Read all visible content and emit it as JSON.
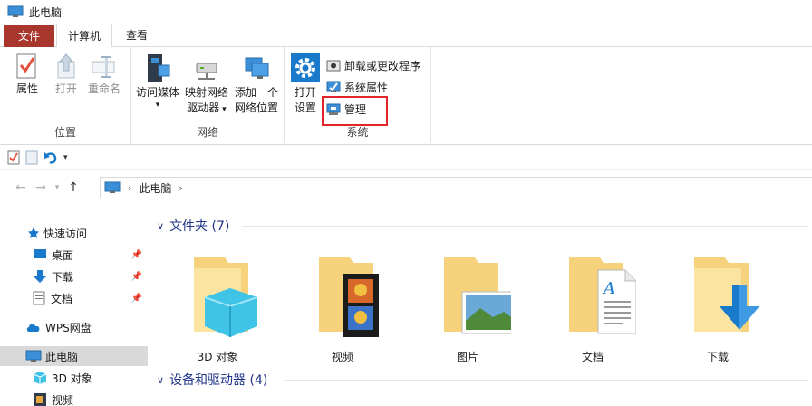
{
  "window": {
    "title": "此电脑"
  },
  "tabs": {
    "file": "文件",
    "computer": "计算机",
    "view": "查看"
  },
  "ribbon": {
    "location": {
      "label": "位置",
      "properties": "属性",
      "open": "打开",
      "rename": "重命名"
    },
    "network": {
      "label": "网络",
      "access_media": "访问媒体",
      "map_drive_line1": "映射网络",
      "map_drive_line2": "驱动器",
      "add_location_line1": "添加一个",
      "add_location_line2": "网络位置"
    },
    "system": {
      "label": "系统",
      "open_settings_line1": "打开",
      "open_settings_line2": "设置",
      "uninstall": "卸载或更改程序",
      "system_properties": "系统属性",
      "manage": "管理"
    }
  },
  "address": {
    "root": "此电脑"
  },
  "sidebar": {
    "items": [
      {
        "label": "快速访问"
      },
      {
        "label": "桌面"
      },
      {
        "label": "下载"
      },
      {
        "label": "文档"
      },
      {
        "label": "WPS网盘"
      },
      {
        "label": "此电脑"
      },
      {
        "label": "3D 对象"
      },
      {
        "label": "视频"
      }
    ]
  },
  "content": {
    "folders_header": "文件夹 (7)",
    "devices_header": "设备和驱动器 (4)",
    "folders": [
      {
        "name": "3D 对象"
      },
      {
        "name": "视频"
      },
      {
        "name": "图片"
      },
      {
        "name": "文档"
      },
      {
        "name": "下载"
      }
    ]
  },
  "colors": {
    "file_tab": "#a8362d",
    "highlight": "#e3242b",
    "folder": "#f6d27c",
    "header_text": "#1e3287"
  }
}
